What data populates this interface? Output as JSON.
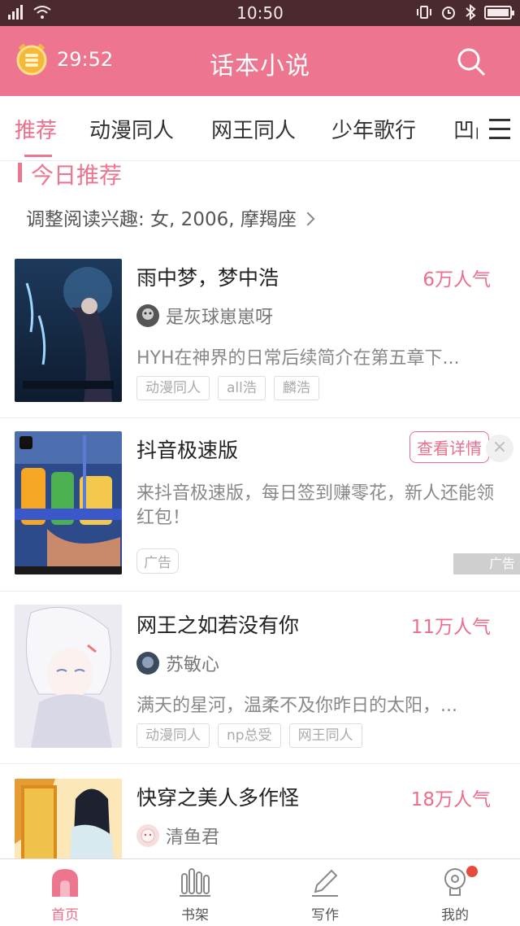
{
  "status_bar": {
    "time": "10:50"
  },
  "header": {
    "timer": "29:52",
    "title": "话本小说"
  },
  "tabs": [
    {
      "label": "推荐",
      "active": true
    },
    {
      "label": "动漫同人"
    },
    {
      "label": "网王同人"
    },
    {
      "label": "少年歌行"
    },
    {
      "label": "凹凸"
    }
  ],
  "section": {
    "title": "今日推荐",
    "interest": "调整阅读兴趣: 女, 2006, 摩羯座"
  },
  "books": [
    {
      "title": "雨中梦，梦中浩",
      "popularity": "6万人气",
      "author": "是灰球崽崽呀",
      "description": "HYH在神界的日常后续简介在第五章下...",
      "tags": [
        "动漫同人",
        "all浩",
        "麟浩"
      ]
    },
    {
      "title": "网王之如若没有你",
      "popularity": "11万人气",
      "author": "苏敏心",
      "description": "满天的星河，温柔不及你昨日的太阳，...",
      "tags": [
        "动漫同人",
        "np总受",
        "网王同人"
      ]
    },
    {
      "title": "快穿之美人多作怪",
      "popularity": "18万人气",
      "author": "清鱼君"
    }
  ],
  "ad": {
    "title": "抖音极速版",
    "button": "查看详情",
    "close": "×",
    "description": "来抖音极速版，每日签到赚零花，新人还能领红包！",
    "tag": "广告",
    "corner_label": "广告"
  },
  "bottom_nav": [
    {
      "label": "首页",
      "active": true
    },
    {
      "label": "书架"
    },
    {
      "label": "写作"
    },
    {
      "label": "我的"
    }
  ],
  "colors": {
    "accent": "#ee7590",
    "status_bar": "#4a2a2e",
    "badge": "#e84b3c"
  }
}
